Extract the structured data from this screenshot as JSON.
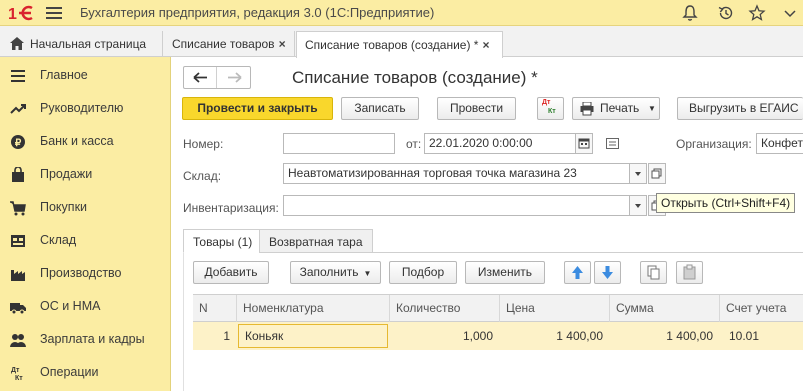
{
  "app": {
    "title": "Бухгалтерия предприятия, редакция 3.0  (1С:Предприятие)"
  },
  "tabs": [
    {
      "label": "Начальная страница"
    },
    {
      "label": "Списание товаров",
      "close": "×"
    },
    {
      "label": "Списание товаров (создание) *",
      "close": "×"
    }
  ],
  "sidebar": {
    "items": [
      {
        "label": "Главное",
        "icon": "menu-lines-icon"
      },
      {
        "label": "Руководителю",
        "icon": "trend-chart-icon"
      },
      {
        "label": "Банк и касса",
        "icon": "coin-icon"
      },
      {
        "label": "Продажи",
        "icon": "shopping-bag-icon"
      },
      {
        "label": "Покупки",
        "icon": "cart-icon"
      },
      {
        "label": "Склад",
        "icon": "warehouse-icon"
      },
      {
        "label": "Производство",
        "icon": "factory-icon"
      },
      {
        "label": "ОС и НМА",
        "icon": "truck-icon"
      },
      {
        "label": "Зарплата и кадры",
        "icon": "people-icon"
      },
      {
        "label": "Операции",
        "icon": "dt-kt-icon"
      }
    ]
  },
  "form": {
    "title": "Списание товаров (создание) *",
    "toolbar": {
      "post_close": "Провести и закрыть",
      "save": "Записать",
      "post": "Провести",
      "dtkt_top": "Дт",
      "dtkt_bottom": "Кт",
      "print": "Печать",
      "egais": "Выгрузить в ЕГАИС"
    },
    "number_label": "Номер:",
    "number_value": "",
    "from_label": "от:",
    "date_value": "22.01.2020  0:00:00",
    "org_label": "Организация:",
    "org_value": "Конфет",
    "warehouse_label": "Склад:",
    "warehouse_value": "Неавтоматизированная торговая точка магазина 23",
    "inventory_label": "Инвентаризация:",
    "inventory_value": "",
    "tooltip": "Открыть (Ctrl+Shift+F4)",
    "inner_tabs": [
      "Товары (1)",
      "Возвратная тара"
    ],
    "table_toolbar": {
      "add": "Добавить",
      "fill": "Заполнить",
      "select": "Подбор",
      "change": "Изменить"
    },
    "columns": [
      "N",
      "Номенклатура",
      "Количество",
      "Цена",
      "Сумма",
      "Счет учета"
    ],
    "rows": [
      {
        "n": "1",
        "item": "Коньяк",
        "qty": "1,000",
        "price": "1 400,00",
        "sum": "1 400,00",
        "account": "10.01"
      }
    ]
  },
  "colors": {
    "accent_yellow": "#f9d72c",
    "sidebar_bg": "#fbeda3",
    "logo_red": "#d9232e",
    "arrow_blue": "#3c8ce0"
  }
}
